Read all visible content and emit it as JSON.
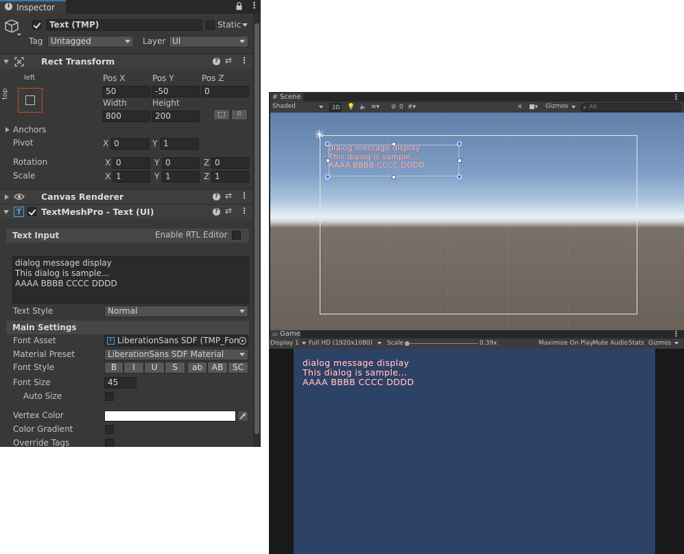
{
  "inspector": {
    "tab_label": "Inspector",
    "object_name": "Text (TMP)",
    "static_label": "Static",
    "tag_label": "Tag",
    "tag_value": "Untagged",
    "layer_label": "Layer",
    "layer_value": "UI"
  },
  "rect_transform": {
    "title": "Rect Transform",
    "anchor_left": "left",
    "anchor_top": "top",
    "pos_x_label": "Pos X",
    "pos_y_label": "Pos Y",
    "pos_z_label": "Pos Z",
    "pos_x": "50",
    "pos_y": "-50",
    "pos_z": "0",
    "width_label": "Width",
    "height_label": "Height",
    "width": "800",
    "height": "200",
    "r_button": "R",
    "anchors_label": "Anchors",
    "pivot_label": "Pivot",
    "pivot_x": "0",
    "pivot_y": "1",
    "rotation_label": "Rotation",
    "rot_x": "0",
    "rot_y": "0",
    "rot_z": "0",
    "scale_label": "Scale",
    "scale_x": "1",
    "scale_y": "1",
    "scale_z": "1",
    "x": "X",
    "y": "Y",
    "z": "Z"
  },
  "canvas_renderer": {
    "title": "Canvas Renderer"
  },
  "tmp": {
    "title": "TextMeshPro - Text (UI)",
    "text_input_label": "Text Input",
    "rtl_label": "Enable RTL Editor",
    "text_lines": [
      "dialog message display",
      "This dialog is sample...",
      "AAAA BBBB CCCC DDDD"
    ],
    "text_style_label": "Text Style",
    "text_style_value": "Normal",
    "main_settings_label": "Main Settings",
    "font_asset_label": "Font Asset",
    "font_asset_value": "LiberationSans SDF (TMP_Fon",
    "material_preset_label": "Material Preset",
    "material_preset_value": "LiberationSans SDF Material",
    "font_style_label": "Font Style",
    "font_style_buttons": [
      "B",
      "I",
      "U",
      "S",
      "ab",
      "AB",
      "SC"
    ],
    "font_size_label": "Font Size",
    "font_size_value": "45",
    "auto_size_label": "Auto Size",
    "vertex_color_label": "Vertex Color",
    "color_gradient_label": "Color Gradient",
    "override_tags_label": "Override Tags"
  },
  "scene": {
    "tab_label": "Scene",
    "shading": "Shaded",
    "mode_2d": "2D",
    "hidden_count": "0",
    "gizmos": "Gizmos",
    "search_placeholder": "All",
    "text_lines": [
      "dialog message display",
      "This dialog is sample...",
      "AAAA BBBB CCCC DDDD"
    ]
  },
  "game": {
    "tab_label": "Game",
    "display": "Display 1",
    "resolution": "Full HD (1920x1080)",
    "scale_label": "Scale",
    "scale_value": "0.39x",
    "maximize": "Maximize On Play",
    "mute": "Mute Audio",
    "stats": "Stats",
    "gizmos": "Gizmos",
    "text_lines": [
      "dialog message display",
      "This dialog is sample...",
      "AAAA BBBB CCCC DDDD"
    ]
  }
}
